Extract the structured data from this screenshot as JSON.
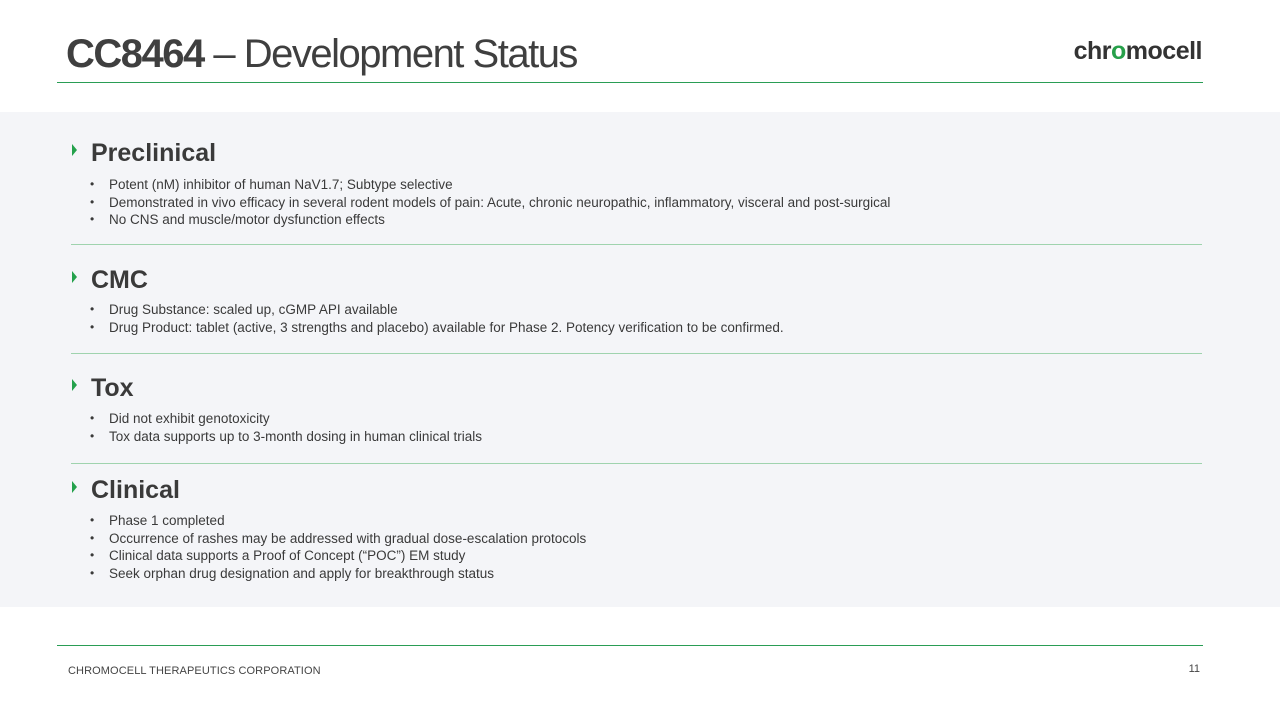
{
  "header": {
    "title_code": "CC8464",
    "title_rest": " – Development Status",
    "logo_part1": "chr",
    "logo_o": "o",
    "logo_part2": "mocell"
  },
  "sections": [
    {
      "title": "Preclinical",
      "bullets": [
        "Potent (nM) inhibitor of human NaV1.7; Subtype selective",
        "Demonstrated in vivo efficacy in several rodent models of pain: Acute, chronic neuropathic, inflammatory, visceral and post-surgical",
        "No CNS and muscle/motor dysfunction effects"
      ]
    },
    {
      "title": "CMC",
      "bullets": [
        "Drug Substance: scaled up, cGMP API available",
        "Drug Product: tablet (active, 3 strengths and placebo) available for Phase 2.  Potency verification to be confirmed."
      ]
    },
    {
      "title": "Tox",
      "bullets": [
        "Did not exhibit genotoxicity",
        "Tox data supports up to 3-month dosing in human clinical trials"
      ]
    },
    {
      "title": "Clinical",
      "bullets": [
        "Phase 1 completed",
        "Occurrence of rashes may be addressed with gradual dose-escalation protocols",
        "Clinical data supports a Proof of Concept (“POC”) EM study",
        "Seek orphan drug designation and apply for breakthrough status"
      ]
    }
  ],
  "footer": {
    "company": "CHROMOCELL THERAPEUTICS CORPORATION",
    "page_number": "11"
  },
  "colors": {
    "accent_green": "#24a14c",
    "panel_bg": "#f4f5f8",
    "text": "#3a3a3a"
  }
}
